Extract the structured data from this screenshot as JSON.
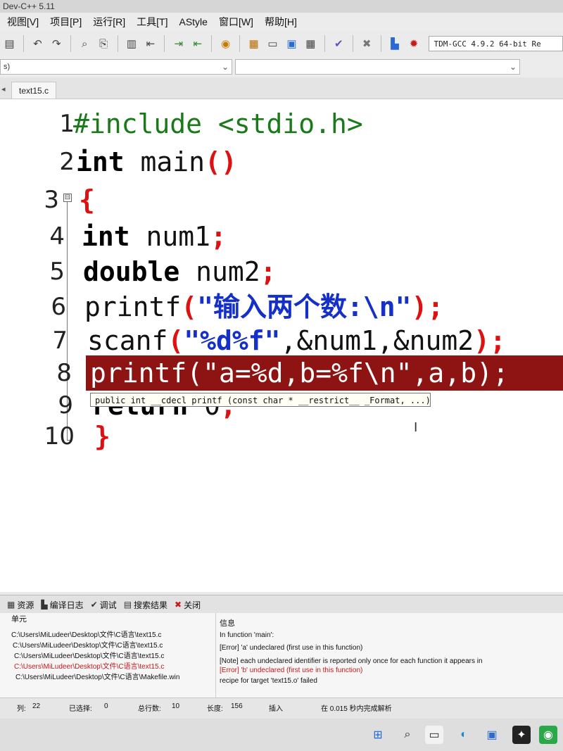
{
  "window": {
    "title": "Dev-C++ 5.11"
  },
  "menu": [
    "视图[V]",
    "项目[P]",
    "运行[R]",
    "工具[T]",
    "AStyle",
    "窗口[W]",
    "帮助[H]"
  ],
  "toolbar": {
    "compiler": "TDM-GCC 4.9.2 64-bit Re",
    "icons": [
      "print-icon",
      "undo-icon",
      "redo-icon",
      "find-icon",
      "replace-icon",
      "indent-icon",
      "unindent-icon",
      "goto-icon",
      "back-icon",
      "bookmark-icon",
      "grid-icon",
      "window-icon",
      "layout-icon",
      "tiles-icon",
      "check-icon",
      "close-icon",
      "chart-icon",
      "debug-icon"
    ]
  },
  "combos": {
    "left_value": "s)",
    "right_value": ""
  },
  "tab": {
    "label": "text15.c"
  },
  "editor": {
    "line_numbers": [
      "1",
      "2",
      "3",
      "4",
      "5",
      "6",
      "7",
      "8",
      "9",
      "10"
    ],
    "lines": {
      "l1_pp": "#include <stdio.h>",
      "l2_kw": "int",
      "l2_rest": " main",
      "l2_sym": "()",
      "l3_sym": "{",
      "l4_kw": "int",
      "l4_rest": " num1",
      "l4_sym": ";",
      "l5_kw": "double",
      "l5_rest": " num2",
      "l5_sym": ";",
      "l6_fn": "printf",
      "l6_p1": "(",
      "l6_str": "\"输入两个数:\\n\"",
      "l6_p2": ");",
      "l7_fn": "scanf",
      "l7_p1": "(",
      "l7_str": "\"%d%f\"",
      "l7_rest": ",&num1,&num2",
      "l7_p2": ");",
      "l8_text": "printf(\"a=%d,b=%f\\n\",a,b);",
      "l9_kw": "return",
      "l9_rest": " 0",
      "l9_sym": ";",
      "l10_sym": "}"
    },
    "hint": "public int __cdecl printf (const char * __restrict__ _Format, ...)",
    "fold_glyph": "⊟"
  },
  "bottom_tabs": [
    "资源",
    "编译日志",
    "调试",
    "搜索结果",
    "关闭"
  ],
  "panel": {
    "col_unit": "单元",
    "col_info": "信息",
    "rows": [
      {
        "unit": "C:\\Users\\MiLudeer\\Desktop\\文件\\C语言\\text15.c",
        "info": "In function 'main':",
        "color": "blk"
      },
      {
        "unit": "C:\\Users\\MiLudeer\\Desktop\\文件\\C语言\\text15.c",
        "info": "[Error] 'a' undeclared (first use in this function)",
        "color": "blk"
      },
      {
        "unit": "C:\\Users\\MiLudeer\\Desktop\\文件\\C语言\\text15.c",
        "info": "[Note] each undeclared identifier is reported only once for each function it appears in",
        "color": "blk"
      },
      {
        "unit": "C:\\Users\\MiLudeer\\Desktop\\文件\\C语言\\text15.c",
        "info": "[Error] 'b' undeclared (first use in this function)",
        "color": "red"
      },
      {
        "unit": "C:\\Users\\MiLudeer\\Desktop\\文件\\C语言\\Makefile.win",
        "info": "recipe for target 'text15.o' failed",
        "color": "blk"
      }
    ]
  },
  "status": {
    "col_label": "列:",
    "col_value": "22",
    "sel_label": "已选择:",
    "sel_value": "0",
    "total_label": "总行数:",
    "total_value": "10",
    "len_label": "长度:",
    "len_value": "156",
    "mode": "插入",
    "parse": "在 0.015 秒内完成解析"
  },
  "taskbar": {
    "icons": [
      "windows-start-icon",
      "search-icon",
      "files-icon",
      "edge-icon",
      "mail-icon",
      "app-icon",
      "wechat-icon"
    ]
  }
}
